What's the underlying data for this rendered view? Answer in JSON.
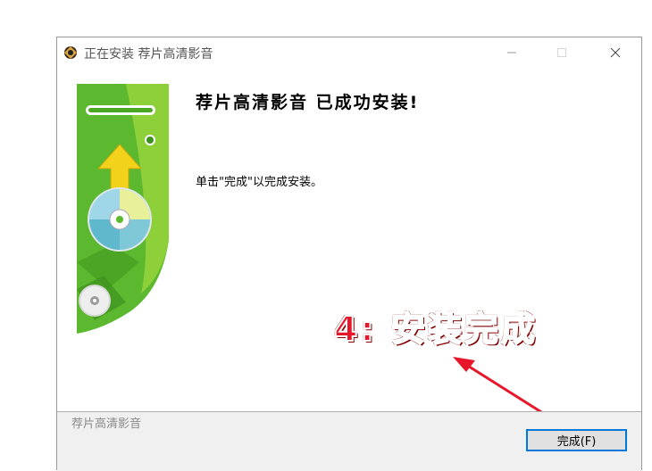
{
  "window": {
    "title": "正在安装 荐片高清影音",
    "controls": {
      "minimize_icon": "minimize-icon",
      "maximize_icon": "maximize-icon",
      "close_icon": "close-icon"
    }
  },
  "main": {
    "heading": "荐片高清影音 已成功安装!",
    "info": "单击\"完成\"以完成安装。"
  },
  "annotation": {
    "text": "4: 安装完成",
    "color": "#e8162a"
  },
  "footer": {
    "brand": "荐片高清影音",
    "finish_label": "完成(F)"
  },
  "colors": {
    "accent": "#0078d7",
    "banner_green": "#5cb82e",
    "arrow_yellow": "#f2d21a"
  }
}
